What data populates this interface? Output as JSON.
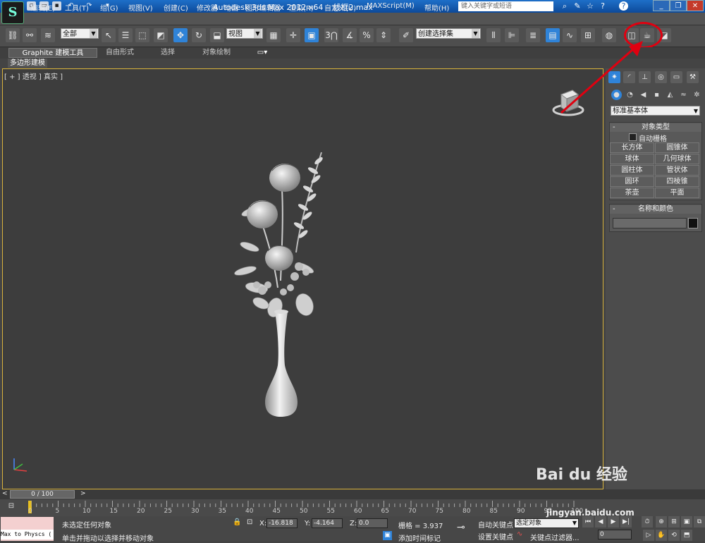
{
  "titlebar": {
    "app_title": "Autodesk 3ds Max  2012 x64",
    "file_name": "线框2.max",
    "search_placeholder": "键入关键字或短语",
    "quick_access": [
      "document-new-icon",
      "folder-open-icon",
      "save-icon",
      "undo-icon",
      "redo-icon",
      "dropdown-icon"
    ]
  },
  "menubar": {
    "items": [
      "编辑(E)",
      "工具(T)",
      "组(G)",
      "视图(V)",
      "创建(C)",
      "修改器",
      "动画",
      "图形编辑器",
      "渲染(R)",
      "自定义(U)",
      "MAXScript(M)",
      "帮助(H)"
    ]
  },
  "toolbar": {
    "selection_filter": "全部",
    "reference_coord": "视图",
    "named_selection": "创建选择集",
    "snap_label": "3",
    "percent_label": "%"
  },
  "ribbon": {
    "tabs": [
      "Graphite 建模工具",
      "自由形式",
      "选择",
      "对象绘制"
    ],
    "subtab": "多边形建模"
  },
  "viewport": {
    "label": "[ + ] 透视 ] 真实 ]"
  },
  "command_panel": {
    "category": "标准基本体",
    "object_type_title": "对象类型",
    "autogrid_label": "自动栅格",
    "object_buttons": [
      "长方体",
      "圆锥体",
      "球体",
      "几何球体",
      "圆柱体",
      "管状体",
      "圆环",
      "四棱锥",
      "茶壶",
      "平面"
    ],
    "name_color_title": "名称和颜色"
  },
  "timeline": {
    "slider_label": "0 / 100",
    "ticks": [
      "0",
      "5",
      "10",
      "15",
      "20",
      "25",
      "30",
      "35",
      "40",
      "45",
      "50",
      "55",
      "60",
      "65",
      "70",
      "75",
      "80",
      "85",
      "90",
      "95",
      "100"
    ]
  },
  "status": {
    "maxscript_text": "Max to Physcs (",
    "selection_status": "未选定任何对象",
    "prompt": "单击并拖动以选择并移动对象",
    "x_label": "X:",
    "x_value": "-16.818",
    "y_label": "Y:",
    "y_value": "-4.164",
    "z_label": "Z:",
    "z_value": "0.0",
    "grid": "栅格 = 3.937",
    "add_time_tag": "添加时间标记",
    "auto_key": "自动关键点",
    "set_key": "设置关键点",
    "selected_option": "选定对象",
    "key_filters": "关键点过滤器...",
    "frame": "0"
  },
  "watermark": {
    "brand": "Bai du 经验",
    "url": "jingyan.baidu.com"
  },
  "colors": {
    "highlight_annotation": "#e00010",
    "viewport_border": "#d9b33c",
    "active_tool": "#2f83d8"
  }
}
